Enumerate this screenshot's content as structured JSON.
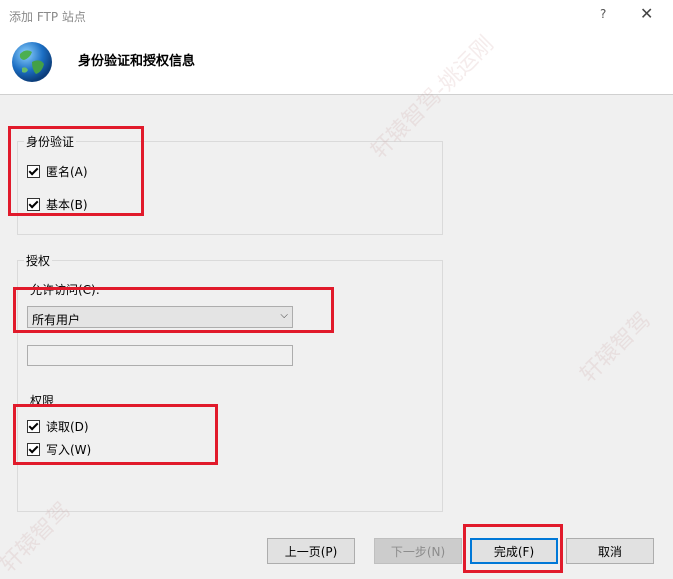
{
  "window": {
    "title": "添加 FTP 站点",
    "help": "?",
    "close": "✕"
  },
  "header": {
    "title": "身份验证和授权信息",
    "icon": "globe-icon"
  },
  "auth": {
    "label": "身份验证",
    "anonymous": {
      "label": "匿名(A)",
      "checked": true
    },
    "basic": {
      "label": "基本(B)",
      "checked": true
    }
  },
  "authorization": {
    "label": "授权",
    "allow_label": "允许访问(C):",
    "allow_value": "所有用户",
    "text_value": "",
    "permissions_label": "权限",
    "read": {
      "label": "读取(D)",
      "checked": true
    },
    "write": {
      "label": "写入(W)",
      "checked": true
    }
  },
  "buttons": {
    "prev": "上一页(P)",
    "next": "下一步(N)",
    "finish": "完成(F)",
    "cancel": "取消"
  },
  "watermark": {
    "text1": "轩辕智驾-姚运刚",
    "text2": "轩辕智驾",
    "text3": "轩辕智驾"
  },
  "colors": {
    "highlight": "#e11a2b",
    "accent": "#0078d7"
  }
}
